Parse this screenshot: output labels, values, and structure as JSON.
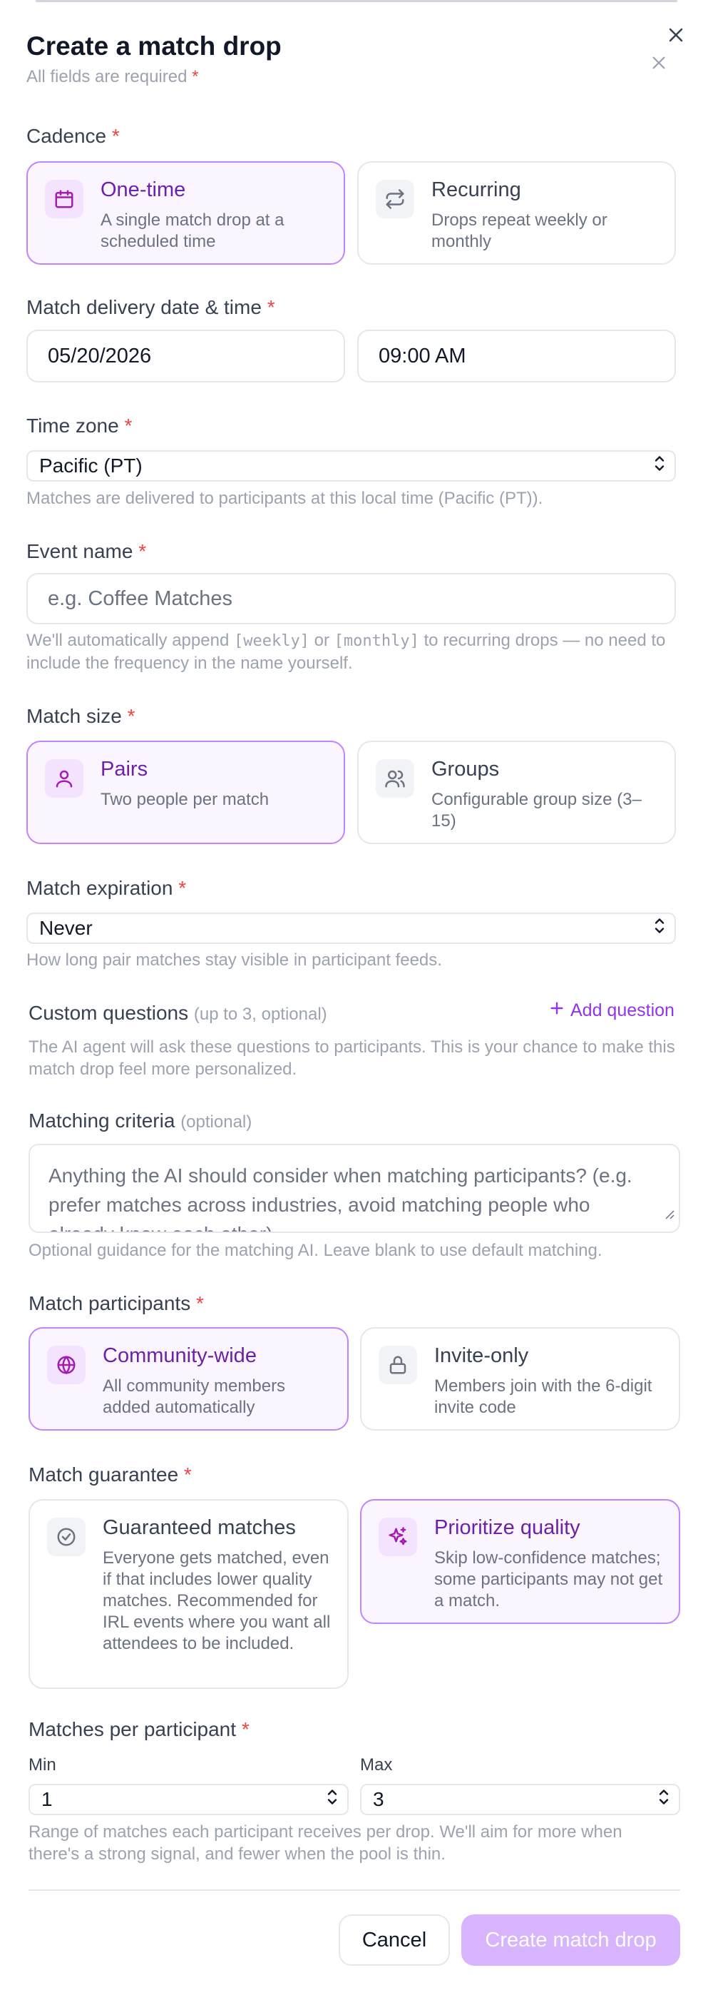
{
  "header": {
    "title": "Create a match drop",
    "subtitle": "All fields are required",
    "required_mark": "*"
  },
  "cadence": {
    "label": "Cadence",
    "options": [
      {
        "title": "One-time",
        "desc": "A single match drop at a scheduled time",
        "icon": "calendar-icon",
        "selected": true
      },
      {
        "title": "Recurring",
        "desc": "Drops repeat weekly or monthly",
        "icon": "repeat-icon",
        "selected": false
      }
    ]
  },
  "delivery": {
    "label": "Match delivery date & time",
    "date_value": "05/20/2026",
    "time_value": "09:00 AM"
  },
  "timezone": {
    "label": "Time zone",
    "value": "Pacific (PT)",
    "help": "Matches are delivered to participants at this local time (Pacific (PT))."
  },
  "event_name": {
    "label": "Event name",
    "placeholder": "e.g. Coffee Matches",
    "help_pre": "We'll automatically append ",
    "help_code1": "[weekly]",
    "help_mid": " or ",
    "help_code2": "[monthly]",
    "help_post": " to recurring drops — no need to include the frequency in the name yourself."
  },
  "match_size": {
    "label": "Match size",
    "options": [
      {
        "title": "Pairs",
        "desc": "Two people per match",
        "icon": "person-icon",
        "selected": true
      },
      {
        "title": "Groups",
        "desc": "Configurable group size (3–15)",
        "icon": "users-icon",
        "selected": false
      }
    ]
  },
  "expiration": {
    "label": "Match expiration",
    "value": "Never",
    "help": "How long pair matches stay visible in participant feeds."
  },
  "custom_questions": {
    "label": "Custom questions",
    "note": "(up to 3, optional)",
    "add_label": "Add question",
    "help": "The AI agent will ask these questions to participants. This is your chance to make this match drop feel more personalized."
  },
  "criteria": {
    "label": "Matching criteria",
    "note": "(optional)",
    "placeholder": "Anything the AI should consider when matching participants? (e.g. prefer matches across industries, avoid matching people who already know each other)",
    "help": "Optional guidance for the matching AI. Leave blank to use default matching."
  },
  "participants": {
    "label": "Match participants",
    "options": [
      {
        "title": "Community-wide",
        "desc": "All community members added automatically",
        "icon": "globe-icon",
        "selected": true
      },
      {
        "title": "Invite-only",
        "desc": "Members join with the 6-digit invite code",
        "icon": "lock-icon",
        "selected": false
      }
    ]
  },
  "guarantee": {
    "label": "Match guarantee",
    "options": [
      {
        "title": "Guaranteed matches",
        "desc": "Everyone gets matched, even if that includes lower quality matches. Recommended for IRL events where you want all attendees to be included.",
        "icon": "check-circle-icon",
        "selected": false
      },
      {
        "title": "Prioritize quality",
        "desc": "Skip low-confidence matches; some participants may not get a match.",
        "icon": "sparkles-icon",
        "selected": true
      }
    ]
  },
  "per_participant": {
    "label": "Matches per participant",
    "min_label": "Min",
    "max_label": "Max",
    "min_value": "1",
    "max_value": "3",
    "help": "Range of matches each participant receives per drop. We'll aim for more when there's a strong signal, and fewer when the pool is thin."
  },
  "footer": {
    "cancel_label": "Cancel",
    "create_label": "Create match drop"
  },
  "colors": {
    "accent": "#9333ea",
    "selected_border": "#c084fc",
    "selected_bg": "#fbf5ff",
    "required": "#ef4444",
    "create_disabled": "#d8b4fe"
  }
}
